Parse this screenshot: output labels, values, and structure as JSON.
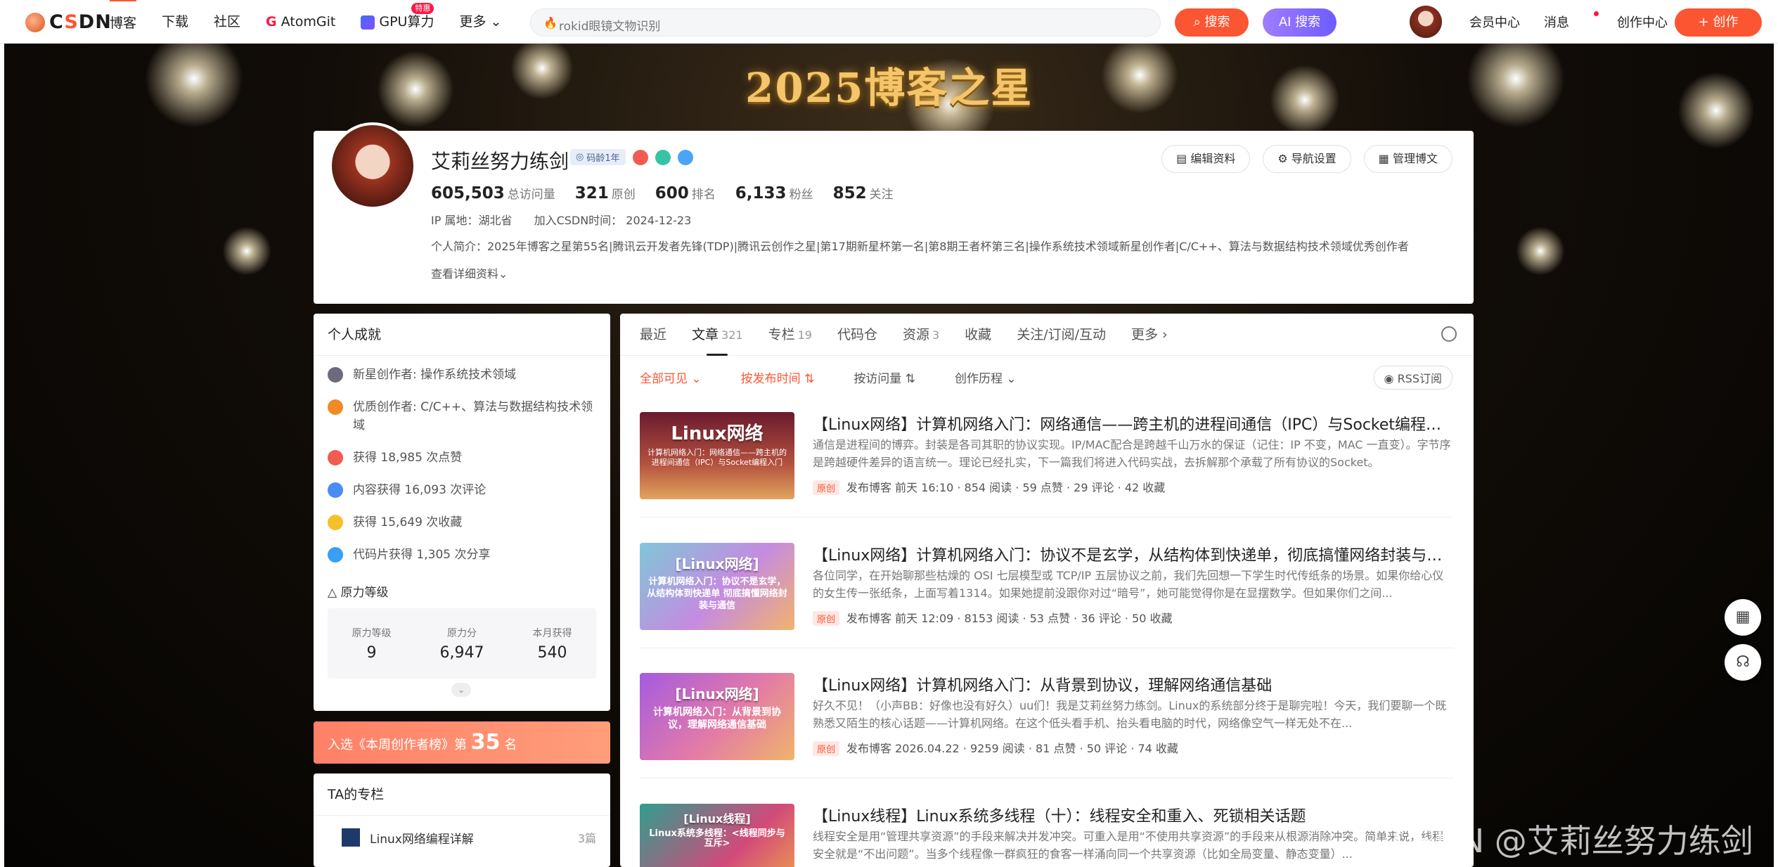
{
  "topbar": {
    "nav": [
      "博客",
      "下载",
      "社区",
      "AtomGit",
      "GPU算力",
      "更多"
    ],
    "atomgit_g": "G",
    "gpu_badge": "特惠",
    "search_placeholder": "rokid眼镜文物识别",
    "search_btn": "搜索",
    "ai_search_btn": "AI 搜索",
    "links": [
      "会员中心",
      "消息",
      "创作中心"
    ],
    "create_btn": "+ 创作"
  },
  "banner": {
    "title": "2025博客之星"
  },
  "profile": {
    "name": "艾莉丝努力练剑",
    "code_age": "码龄1年",
    "stats": [
      {
        "value": "605,503",
        "label": "总访问量"
      },
      {
        "value": "321",
        "label": "原创"
      },
      {
        "value": "600",
        "label": "排名"
      },
      {
        "value": "6,133",
        "label": "粉丝"
      },
      {
        "value": "852",
        "label": "关注"
      }
    ],
    "ip": "IP 属地：湖北省",
    "joined": "加入CSDN时间：  2024-12-23",
    "intro": "个人简介：2025年博客之星第55名|腾讯云开发者先锋(TDP)|腾讯云创作之星|第17期新星杯第一名|第8期王者杯第三名|操作系统技术领域新星创作者|C/C++、算法与数据结构技术领域优秀创作者",
    "more": "查看详细资料",
    "buttons": [
      "编辑资料",
      "导航设置",
      "管理博文"
    ]
  },
  "achievements": {
    "title": "个人成就",
    "items": [
      "新星创作者: 操作系统技术领域",
      "优质创作者: C/C++、算法与数据结构技术领域",
      "获得 18,985 次点赞",
      "内容获得 16,093 次评论",
      "获得 15,649 次收藏",
      "代码片获得 1,305 次分享"
    ],
    "level_title": "原力等级",
    "level": [
      {
        "label": "原力等级",
        "value": "9"
      },
      {
        "label": "原力分",
        "value": "6,947"
      },
      {
        "label": "本月获得",
        "value": "540"
      }
    ]
  },
  "rank": {
    "prefix": "入选《本周创作者榜》第",
    "num": "35",
    "suffix": "名"
  },
  "columns": {
    "title": "TA的专栏",
    "items": [
      {
        "name": "Linux网络编程详解",
        "count": "3篇"
      }
    ]
  },
  "tabs": [
    {
      "label": "最近",
      "count": ""
    },
    {
      "label": "文章",
      "count": "321"
    },
    {
      "label": "专栏",
      "count": "19"
    },
    {
      "label": "代码仓",
      "count": ""
    },
    {
      "label": "资源",
      "count": "3"
    },
    {
      "label": "收藏",
      "count": ""
    },
    {
      "label": "关注/订阅/互动",
      "count": ""
    },
    {
      "label": "更多",
      "count": ""
    }
  ],
  "filters": [
    "全部可见",
    "按发布时间",
    "按访问量",
    "创作历程"
  ],
  "rss": "RSS订阅",
  "articles": [
    {
      "thumb_title": "Linux网络",
      "thumb_sub": "计算机网络入门：网络通信——跨主机的进程间通信（IPC）与Socket编程入门",
      "title": "【Linux网络】计算机网络入门：网络通信——跨主机的进程间通信（IPC）与Socket编程入门",
      "desc": "通信是进程间的博弈。封装是各司其职的协议实现。IP/MAC配合是跨越千山万水的保证（记住：IP 不变，MAC 一直变）。字节序是跨越硬件差异的语言统一。理论已经扎实，下一篇我们将进入代码实战，去拆解那个承载了所有协议的Socket。",
      "tag": "原创",
      "meta": "发布博客 前天 16:10 · 854 阅读 · 59 点赞 · 29 评论 · 42 收藏"
    },
    {
      "thumb_title": "[Linux网络]",
      "thumb_sub": "计算机网络入门：协议不是玄学，从结构体到快递单 彻底搞懂网络封装与通信",
      "title": "【Linux网络】计算机网络入门：协议不是玄学，从结构体到快递单，彻底搞懂网络封装与通信",
      "desc": "各位同学，在开始聊那些枯燥的 OSI 七层模型或 TCP/IP 五层协议之前，我们先回想一下学生时代传纸条的场景。如果你给心仪的女生传一张纸条，上面写着1314。如果她提前没跟你对过“暗号”，她可能觉得你是在显摆数学。但如果你们之间...",
      "tag": "原创",
      "meta": "发布博客 前天 12:09 · 8153 阅读 · 53 点赞 · 36 评论 · 50 收藏"
    },
    {
      "thumb_title": "[Linux网络]",
      "thumb_sub": "计算机网络入门：从背景到协议，理解网络通信基础",
      "title": "【Linux网络】计算机网络入门：从背景到协议，理解网络通信基础",
      "desc": "好久不见！（小声BB：好像也没有好久）uu们！我是艾莉丝努力练剑。Linux的系统部分终于是聊完啦！今天，我们要聊一个既熟悉又陌生的核心话题——计算机网络。在这个低头看手机、抬头看电脑的时代，网络像空气一样无处不在...",
      "tag": "原创",
      "meta": "发布博客 2026.04.22 · 9259 阅读 · 81 点赞 · 50 评论 · 74 收藏"
    },
    {
      "thumb_title": "[Linux线程]",
      "thumb_sub": "Linux系统多线程：<线程同步与互斥>",
      "title": "【Linux线程】Linux系统多线程（十）：线程安全和重入、死锁相关话题",
      "desc": "线程安全是用“管理共享资源”的手段来解决并发冲突。可重入是用“不使用共享资源”的手段来从根源消除冲突。简单来说，线程安全就是“不出问题”。当多个线程像一群疯狂的食客一样涌向同一个共享资源（比如全局变量、静态变量）...",
      "tag": "原创",
      "meta": ""
    }
  ],
  "watermark": "CSDN @艾莉丝努力练剑"
}
